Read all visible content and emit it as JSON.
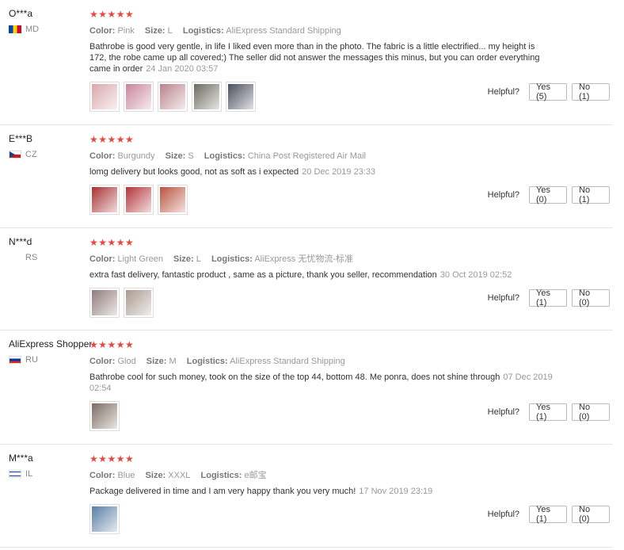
{
  "labels": {
    "color": "Color:",
    "size": "Size:",
    "logistics": "Logistics:",
    "helpful": "Helpful?"
  },
  "colors": {
    "star": "#e8473e",
    "border": "#e6e6e6"
  },
  "reviews": [
    {
      "user": "O***a",
      "country": "MD",
      "flag": "md-flag-icon",
      "stars": "★★★★★",
      "color": "Pink",
      "size": "L",
      "logistics": "AliExpress Standard Shipping",
      "text": "Bathrobe is good very gentle, in life I liked even more than in the photo. The fabric is a little electrified... my height is 172, the robe came up all covered;) The seller did not answer the messages this minus, but you can order everything came in order",
      "date": "24 Jan 2020 03:57",
      "yes": "Yes (5)",
      "no": "No (1)",
      "photos": [
        "#d9a7ae",
        "#c9869b",
        "#b9848c",
        "#6d6a5f",
        "#4b4e5d"
      ]
    },
    {
      "user": "E***B",
      "country": "CZ",
      "flag": "cz-flag-icon",
      "stars": "★★★★★",
      "color": "Burgundy",
      "size": "S",
      "logistics": "China Post Registered Air Mail",
      "text": "lomg delivery but looks good, not as soft as i expected",
      "date": "20 Dec 2019 23:33",
      "yes": "Yes (0)",
      "no": "No (1)",
      "photos": [
        "#a63133",
        "#b2343a",
        "#b9543f"
      ]
    },
    {
      "user": "N***d",
      "country": "RS",
      "flag": "",
      "stars": "★★★★★",
      "color": "Light Green",
      "size": "L",
      "logistics": "AliExpress 无忧物流-标准",
      "text": "extra fast delivery, fantastic product , same as a picture, thank you seller, recommendation",
      "date": "30 Oct 2019 02:52",
      "yes": "Yes (1)",
      "no": "No (0)",
      "photos": [
        "#8f7c7a",
        "#a99a8f"
      ]
    },
    {
      "user": "AliExpress Shopper",
      "country": "RU",
      "flag": "ru-flag-icon",
      "stars": "★★★★★",
      "color": "Glod",
      "size": "M",
      "logistics": "AliExpress Standard Shipping",
      "text": "Bathrobe cool for such money, took on the size of the top 44, bottom 48. Me ponra, does not shine through",
      "date": "07 Dec 2019 02:54",
      "yes": "Yes (1)",
      "no": "No (0)",
      "photos": [
        "#7d6b63"
      ]
    },
    {
      "user": "M***a",
      "country": "IL",
      "flag": "il-flag-icon",
      "stars": "★★★★★",
      "color": "Blue",
      "size": "XXXL",
      "logistics": "e邮宝",
      "text": "Package delivered in time and I am very happy thank you very much!",
      "date": "17 Nov 2019 23:19",
      "yes": "Yes (1)",
      "no": "No (0)",
      "photos": [
        "#5b7fa6"
      ]
    }
  ]
}
